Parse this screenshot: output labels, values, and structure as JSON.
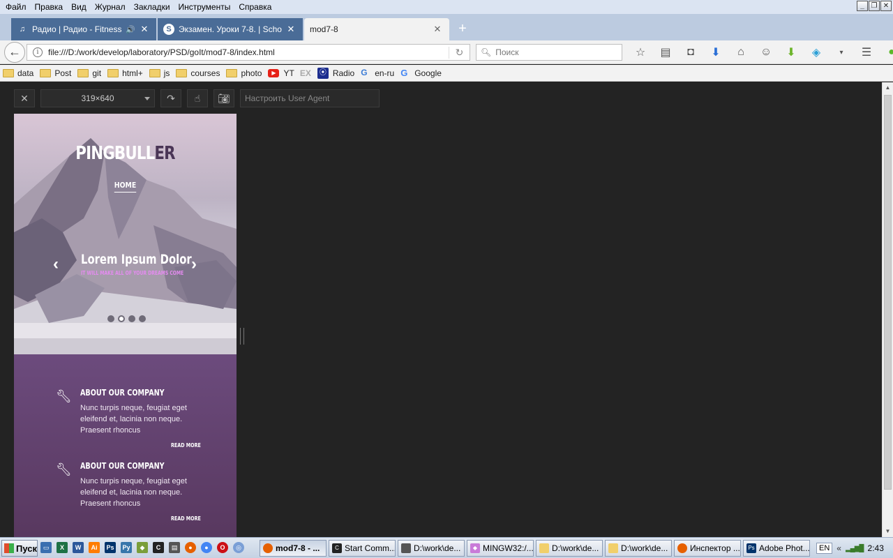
{
  "menubar": {
    "items": [
      "Файл",
      "Правка",
      "Вид",
      "Журнал",
      "Закладки",
      "Инструменты",
      "Справка"
    ]
  },
  "tabs": [
    {
      "title": "Радио | Радио - Fitness ...",
      "icon": "music-note-icon",
      "muted_icon": "speaker-icon"
    },
    {
      "title": "Экзамен. Уроки 7-8. | Schoo...",
      "icon": "skype-icon"
    },
    {
      "title": "mod7-8",
      "active": true
    }
  ],
  "navbar": {
    "url": "file:///D:/work/develop/laboratory/PSD/goIt/mod7-8/index.html",
    "search_placeholder": "Поиск"
  },
  "bookmarks": {
    "items": [
      "data",
      "Post",
      "git",
      "html+",
      "js",
      "courses",
      "photo",
      "YT",
      "EX",
      "Radio",
      "en-ru",
      "Google"
    ]
  },
  "rdm": {
    "size_label": "319×640",
    "ua_placeholder": "Настроить User Agent"
  },
  "site": {
    "logo_main": "PINGBULL",
    "logo_accent": "ER",
    "nav_home": "HOME",
    "slide_title": "Lorem Ipsum Dolor",
    "slide_subtitle": "IT WILL MAKE ALL OF YOUR DREAMS COME",
    "slider_total": 4,
    "slider_active": 2,
    "features": [
      {
        "title": "ABOUT OUR COMPANY",
        "text": "Nunc turpis neque, feugiat eget eleifend et, lacinia non neque. Praesent rhoncus",
        "more": "READ MORE"
      },
      {
        "title": "ABOUT OUR COMPANY",
        "text": "Nunc turpis neque, feugiat eget eleifend et, lacinia non neque. Praesent rhoncus",
        "more": "READ MORE"
      }
    ]
  },
  "taskbar": {
    "start_label": "Пуск",
    "tasks": [
      "mod7-8 - ...",
      "Start Comm...",
      "D:\\work\\de...",
      "MINGW32:/...",
      "D:\\work\\de...",
      "D:\\work\\de...",
      "Инспектор ...",
      "Adobe Phot..."
    ],
    "lang": "EN",
    "clock": "2:43"
  },
  "colors": {
    "brand_purple": "#6c4b7d",
    "accent_pink": "#e58bf0",
    "tab_inactive": "#4a6c97"
  }
}
